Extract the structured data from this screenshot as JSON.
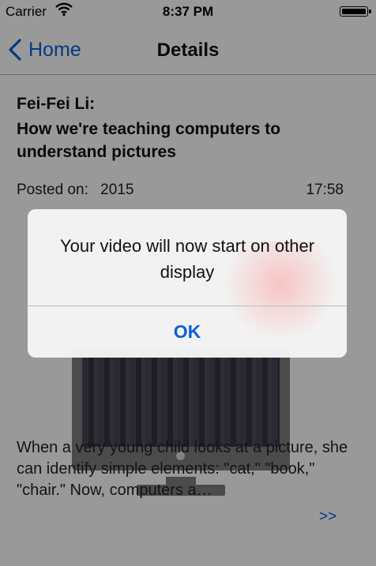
{
  "status_bar": {
    "carrier": "Carrier",
    "time": "8:37 PM",
    "wifi_icon": "wifi-icon",
    "battery_icon": "battery-icon"
  },
  "nav_bar": {
    "back_label": "Home",
    "back_icon": "chevron-left-icon",
    "title": "Details"
  },
  "talk": {
    "speaker": "Fei-Fei Li:",
    "title": "How we're teaching computers to understand pictures",
    "posted_label": "Posted on:",
    "posted_year": "2015",
    "duration": "17:58",
    "description": "When a very young child looks at a picture, she can identify simple elements: \"cat,\" \"book,\" \"chair.\" Now, computers a…",
    "more_link": ">>"
  },
  "alert": {
    "message": "Your video will now start on other display",
    "ok_label": "OK"
  },
  "colors": {
    "accent": "#0a60d8",
    "overlay": "rgba(0,0,0,0.40)"
  }
}
